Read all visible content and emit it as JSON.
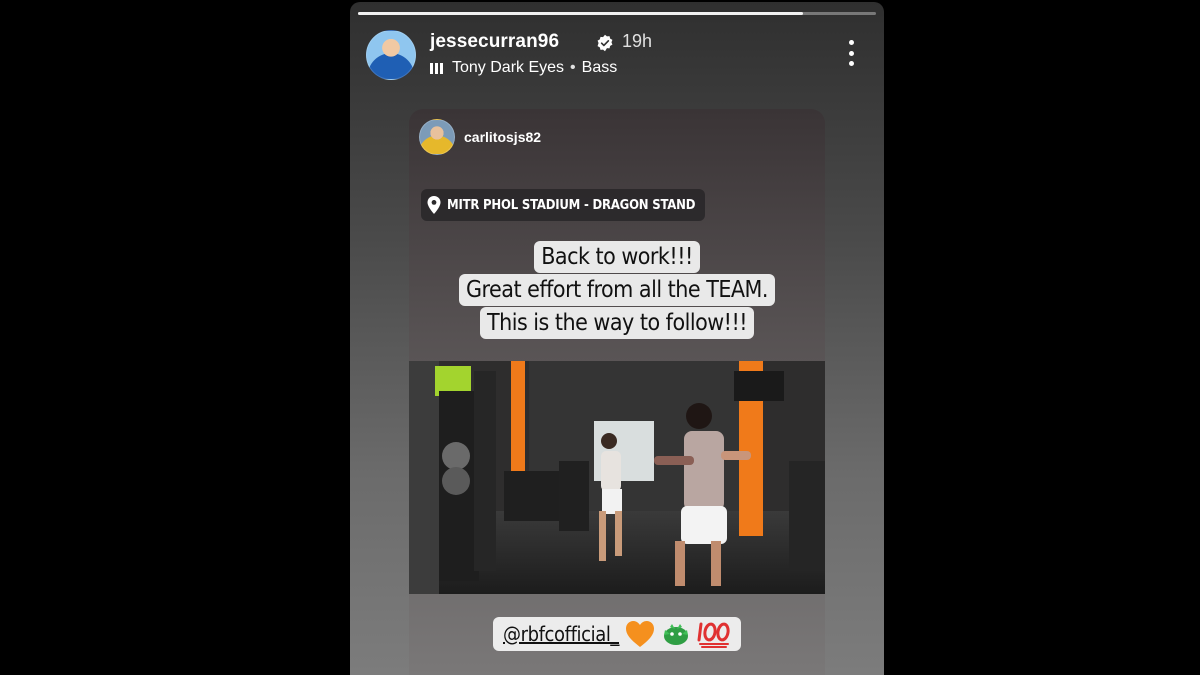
{
  "story": {
    "progress": 0.86,
    "author": {
      "username": "jessecurran96",
      "verified": true,
      "time_ago": "19h"
    },
    "music": {
      "song": "Tony Dark Eyes",
      "separator": "•",
      "artist": "Bass"
    },
    "more_icon": "more-vertical-icon"
  },
  "repost": {
    "username": "carlitosjs82",
    "location": "MITR PHOL STADIUM - DRAGON STAND",
    "caption_lines": [
      "Back to work!!!",
      "Great effort from all the TEAM.",
      "This is the way to follow!!!"
    ],
    "mention": "@rbfcofficial_",
    "mention_emojis": [
      "orange-heart",
      "dragon",
      "hundred-points"
    ]
  },
  "colors": {
    "accent_orange": "#f07a1a",
    "sticker_bg": "#e9e9e9",
    "verified_blue": "#3797f0"
  }
}
